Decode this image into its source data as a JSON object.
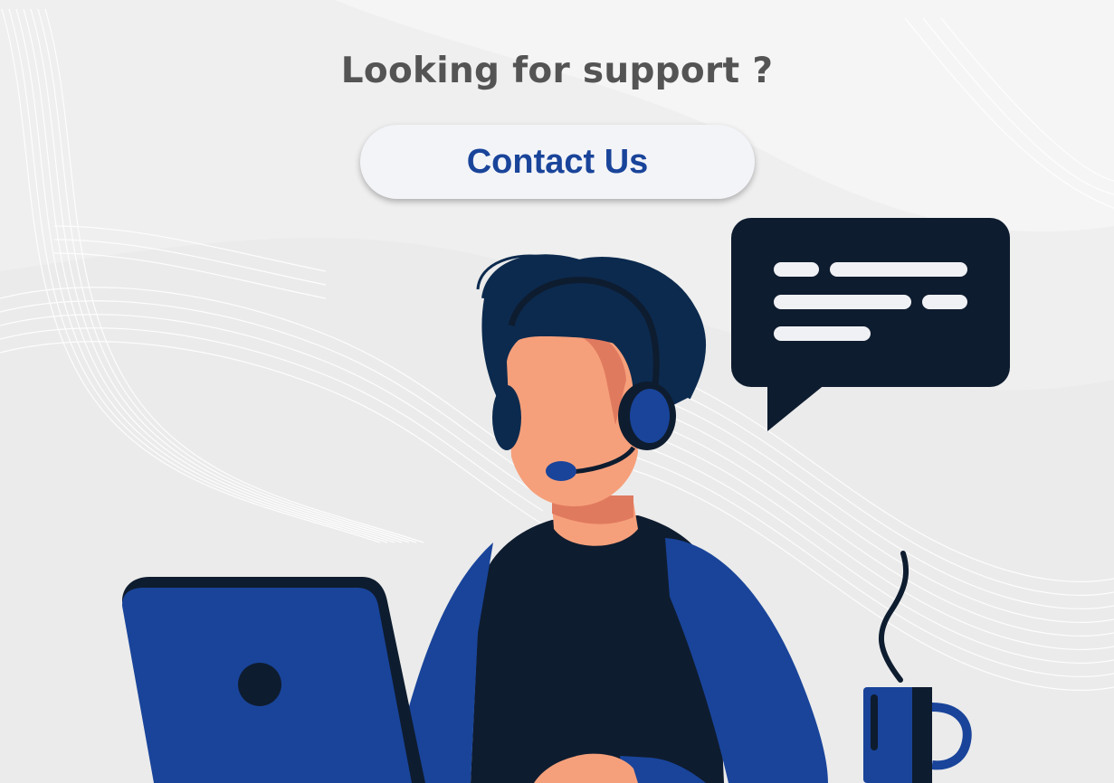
{
  "heading": {
    "text": "Looking for support ?"
  },
  "cta": {
    "label": "Contact Us"
  },
  "colors": {
    "background": "#efefef",
    "heading_text": "#545454",
    "button_bg": "#f3f4f8",
    "button_text": "#19449a",
    "navy": "#0e1c2f",
    "royal_blue": "#19449a",
    "hair": "#0c2a4e",
    "skin": "#f6a07b",
    "skin_shadow": "#e07a5f",
    "bubble_lines": "#f0f1f5"
  },
  "illustration": {
    "icons": [
      "support-agent-illustration",
      "headset-icon",
      "chat-bubble-icon",
      "laptop-icon",
      "coffee-mug-icon",
      "steam-icon"
    ]
  }
}
